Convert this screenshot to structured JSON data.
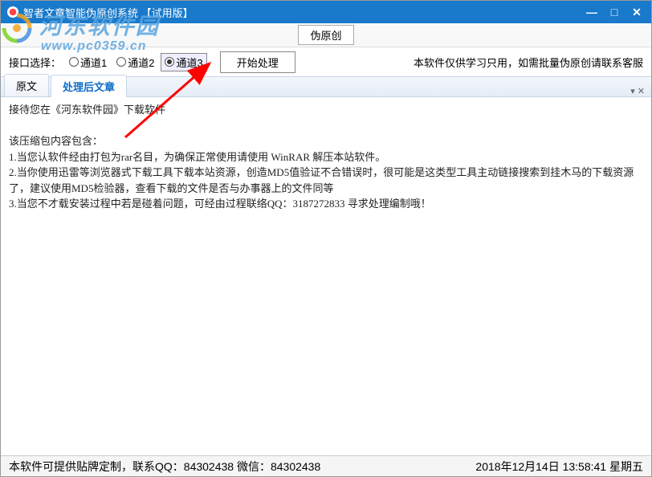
{
  "window": {
    "title": "智者文章智能伪原创系统 【试用版】"
  },
  "watermark": {
    "text": "河东软件园",
    "url": "www.pc0359.cn"
  },
  "toolbar": {
    "fake_original_btn": "伪原创",
    "interface_label": "接口选择：",
    "channel1": "通道1",
    "channel2": "通道2",
    "channel3": "通道3",
    "process_btn": "开始处理",
    "notice": "本软件仅供学习只用，如需批量伪原创请联系客服"
  },
  "tabs": {
    "original": "原文",
    "processed": "处理后文章"
  },
  "content": {
    "line1": "接待您在《河东软件园》下载软件",
    "line2": "该压缩包内容包含：",
    "line3": "1.当您认软件经由打包为rar名目，为确保正常使用请使用 WinRAR 解压本站软件。",
    "line4": "2.当你使用迅雷等浏览器式下载工具下载本站资源，创造MD5值验证不合错误时，很可能是这类型工具主动链接搜索到挂木马的下载资源了，建议使用MD5检验器，查看下载的文件是否与办事器上的文件同等",
    "line5": "3.当您不才载安装过程中若是碰着问题，可经由过程联络QQ：3187272833 寻求处理编制哦！"
  },
  "statusbar": {
    "left": "本软件可提供贴牌定制，联系QQ：84302438 微信：84302438",
    "right": "2018年12月14日 13:58:41 星期五"
  }
}
